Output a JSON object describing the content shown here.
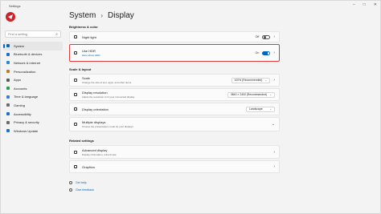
{
  "app": {
    "title": "Settings"
  },
  "search": {
    "placeholder": "Find a setting"
  },
  "nav": {
    "items": [
      {
        "label": "System",
        "color": "#0067c0"
      },
      {
        "label": "Bluetooth & devices",
        "color": "#1f6fd1"
      },
      {
        "label": "Network & internet",
        "color": "#2b88d8"
      },
      {
        "label": "Personalization",
        "color": "#c07a28"
      },
      {
        "label": "Apps",
        "color": "#5a5a5a"
      },
      {
        "label": "Accounts",
        "color": "#2a9d4a"
      },
      {
        "label": "Time & language",
        "color": "#3a7bd5"
      },
      {
        "label": "Gaming",
        "color": "#6b6b6b"
      },
      {
        "label": "Accessibility",
        "color": "#1f6fd1"
      },
      {
        "label": "Privacy & security",
        "color": "#6b6b6b"
      },
      {
        "label": "Windows Update",
        "color": "#1f6fd1"
      }
    ]
  },
  "header": {
    "parent": "System",
    "separator": "›",
    "current": "Display"
  },
  "sections": {
    "brightness": "Brightness & color",
    "scale": "Scale & layout",
    "related": "Related settings"
  },
  "cards": {
    "night_light": {
      "title": "Night light",
      "state": "Off"
    },
    "hdr": {
      "title": "Use HDR",
      "link": "More about HDR",
      "state": "On"
    },
    "scale": {
      "title": "Scale",
      "desc": "Change the size of text, apps, and other items",
      "value": "100% (Recommended)"
    },
    "resolution": {
      "title": "Display resolution",
      "desc": "Adjust the resolution to fit your connected display",
      "value": "3840 × 2400 (Recommended)"
    },
    "orientation": {
      "title": "Display orientation",
      "value": "Landscape"
    },
    "multiple": {
      "title": "Multiple displays",
      "desc": "Choose the presentation mode for your displays"
    },
    "advanced": {
      "title": "Advanced display",
      "desc": "Display information, refresh rate"
    },
    "graphics": {
      "title": "Graphics"
    }
  },
  "footer": {
    "help": "Get help",
    "feedback": "Give feedback"
  },
  "colors": {
    "accent": "#0067c0",
    "highlight": "#e03a3a"
  }
}
